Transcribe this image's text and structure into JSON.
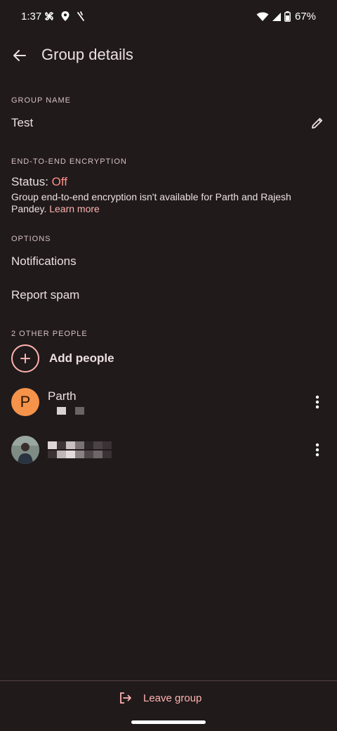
{
  "status_bar": {
    "time": "1:37",
    "battery": "67%"
  },
  "header": {
    "title": "Group details"
  },
  "group_name": {
    "header": "GROUP NAME",
    "value": "Test"
  },
  "encryption": {
    "header": "END-TO-END ENCRYPTION",
    "status_label": "Status:",
    "status_value": "Off",
    "description": "Group end-to-end encryption isn't available for Parth and Rajesh Pandey.",
    "learn_more": "Learn more"
  },
  "options": {
    "header": "OPTIONS",
    "notifications": "Notifications",
    "report_spam": "Report spam"
  },
  "people": {
    "header": "2 OTHER PEOPLE",
    "add_label": "Add people",
    "members": [
      {
        "initial": "P",
        "name": "Parth"
      }
    ]
  },
  "footer": {
    "leave_label": "Leave group"
  },
  "colors": {
    "background": "#201a1b",
    "accent": "#ffb3b0",
    "status_off": "#ff8e86",
    "avatar_orange": "#f5934a"
  }
}
